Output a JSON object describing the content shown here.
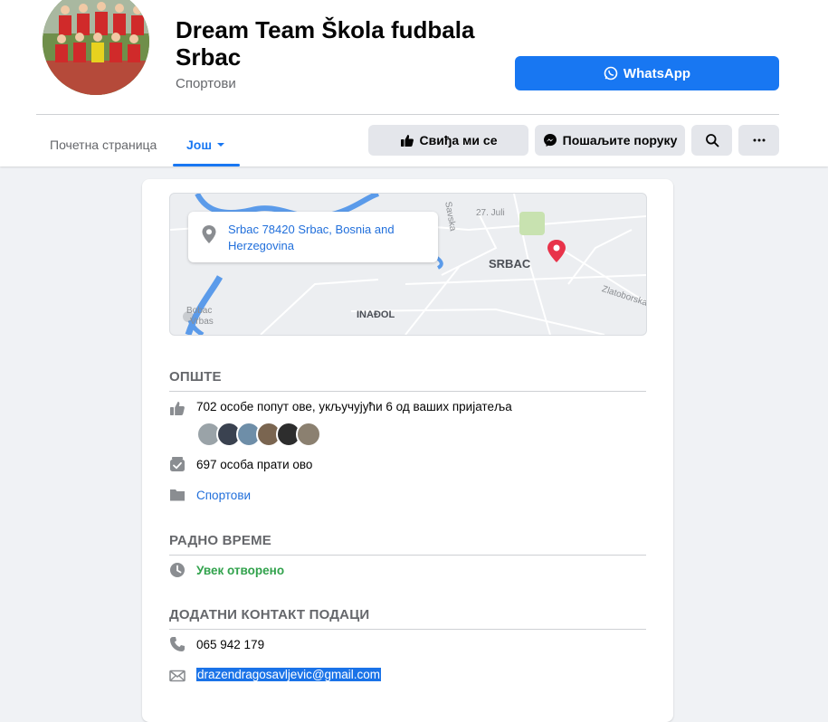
{
  "header": {
    "page_name": "Dream Team Škola fudbala Srbac",
    "category": "Спортови",
    "whatsapp_label": "WhatsApp"
  },
  "tabs": [
    {
      "label": "Почетна страница"
    },
    {
      "label": "Још"
    }
  ],
  "actions": {
    "like_label": "Свиђа ми се",
    "message_label": "Пошаљите поруку"
  },
  "map": {
    "address": "Srbac 78420 Srbac, Bosnia and Herzegovina",
    "labels": {
      "srbac": "SRBAC",
      "inadol": "INAĐOL",
      "savska": "Savska",
      "jul": "27. Juli",
      "zlatoborska": "Zlatoborska",
      "bobac": "Bobac",
      "vrbas": "Vrbas"
    }
  },
  "general": {
    "title": "ОПШТЕ",
    "likes_text": "702 особе попут ове, укључујући 6 од ваших пријатеља",
    "followers_text": "697 особа прати ово",
    "category_link": "Спортови"
  },
  "hours": {
    "title": "РАДНО ВРЕМЕ",
    "status": "Увек отворено"
  },
  "contact": {
    "title": "ДОДАТНИ КОНТАКТ ПОДАЦИ",
    "phone": "065 942 179",
    "email": "drazendragosavljevic@gmail.com"
  },
  "colors": {
    "accent": "#1877f2",
    "link": "#216fdb",
    "open_green": "#31a24c",
    "map_river": "#4a90e2",
    "map_pin": "#e8334a"
  }
}
